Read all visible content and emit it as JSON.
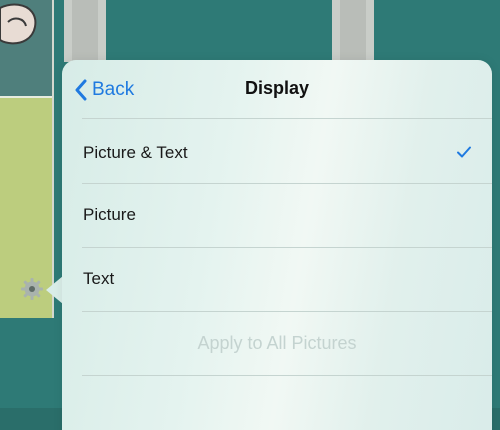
{
  "popover": {
    "back_label": "Back",
    "title": "Display",
    "options": [
      {
        "label": "Picture & Text",
        "selected": true
      },
      {
        "label": "Picture",
        "selected": false
      },
      {
        "label": "Text",
        "selected": false
      }
    ],
    "apply_label": "Apply to All Pictures",
    "apply_enabled": false
  },
  "icons": {
    "back": "chevron-left-icon",
    "check": "checkmark-icon",
    "gear": "gear-icon",
    "mascot": "mascot-icon"
  },
  "colors": {
    "accent": "#1f7ae0",
    "background_teal": "#2e7a76",
    "disabled_text": "#c4d3d0"
  }
}
